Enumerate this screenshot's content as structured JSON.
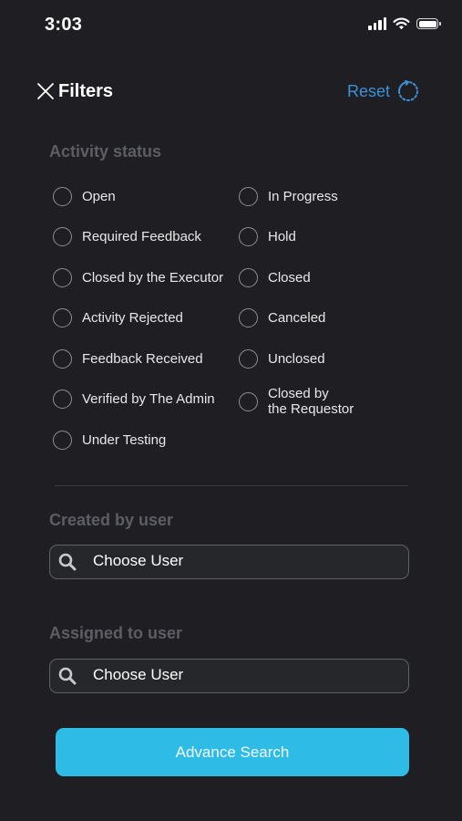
{
  "status_bar": {
    "time": "3:03",
    "icons": [
      "cellular-signal-icon",
      "wifi-icon",
      "battery-icon"
    ]
  },
  "header": {
    "title": "Filters",
    "reset_label": "Reset",
    "close_icon": "close-icon",
    "reset_icon": "refresh-icon"
  },
  "activity_status": {
    "title": "Activity status",
    "options": [
      {
        "label": "Open",
        "selected": false
      },
      {
        "label": "In Progress",
        "selected": false
      },
      {
        "label": "Required Feedback",
        "selected": false
      },
      {
        "label": "Hold",
        "selected": false
      },
      {
        "label": "Closed by the Executor",
        "selected": false
      },
      {
        "label": "Closed",
        "selected": false
      },
      {
        "label": "Activity Rejected",
        "selected": false
      },
      {
        "label": "Canceled",
        "selected": false
      },
      {
        "label": "Feedback Received",
        "selected": false
      },
      {
        "label": "Unclosed",
        "selected": false
      },
      {
        "label": "Verified by The Admin",
        "selected": false
      },
      {
        "label": "Closed by\nthe Requestor",
        "selected": false
      },
      {
        "label": "Under Testing",
        "selected": false
      }
    ]
  },
  "created_by": {
    "title": "Created by user",
    "placeholder": "Choose User"
  },
  "assigned_to": {
    "title": "Assigned to user",
    "placeholder": "Choose User"
  },
  "advance_search_label": "Advance Search",
  "colors": {
    "background": "#1f1f23",
    "accent": "#2ebbe6",
    "link": "#3e8fd9",
    "section_title": "#5c5e64"
  }
}
